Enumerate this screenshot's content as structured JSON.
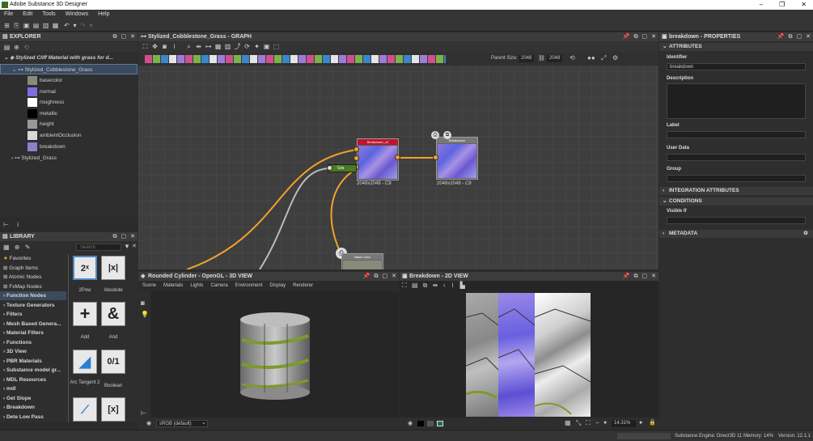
{
  "app": {
    "title": "Adobe Substance 3D Designer",
    "window_controls": [
      "–",
      "❐",
      "✕"
    ]
  },
  "menu": [
    "File",
    "Edit",
    "Tools",
    "Windows",
    "Help"
  ],
  "explorer": {
    "title": "EXPLORER",
    "package": "Stylized Cliff Material with grass for d...",
    "graph": "Stylized_Cobblestone_Grass",
    "outputs": [
      "basecolor",
      "normal",
      "roughness",
      "metallic",
      "height",
      "ambientOcclusion",
      "breakdown"
    ],
    "other_graph": "Stylized_Grass"
  },
  "library": {
    "title": "LIBRARY",
    "search_placeholder": "Search",
    "categories": [
      "Favorites",
      "Graph Items",
      "Atomic Nodes",
      "FxMap Nodes",
      "Function Nodes",
      "Texture Generators",
      "Filters",
      "Mesh Based Genera...",
      "Material Filters",
      "Functions",
      "3D View",
      "PBR Materials",
      "Substance model gr...",
      "MDL Resources",
      "mdl",
      "Get Slope",
      "Breakdown",
      "Dete Low Pass"
    ],
    "selected_category": "Function Nodes",
    "tiles": [
      {
        "glyph": "2ˣ",
        "caption": "2Pow"
      },
      {
        "glyph": "|x|",
        "caption": "Absolute"
      },
      {
        "glyph": "+",
        "caption": "Add"
      },
      {
        "glyph": "&",
        "caption": "And"
      },
      {
        "glyph": "◢",
        "caption": "Arc Tangent 2"
      },
      {
        "glyph": "0/1",
        "caption": "Boolean"
      },
      {
        "glyph": "⟋",
        "caption": ""
      },
      {
        "glyph": "[x]",
        "caption": ""
      }
    ]
  },
  "graph": {
    "title": "Stylized_Cobblestone_Grass - GRAPH",
    "parent_size_label": "Parent Size:",
    "parent_size": "2048",
    "size_b": "2048",
    "nodes": [
      {
        "name": "Breakdown_x2",
        "size": "2048x2048 - C8"
      },
      {
        "name": "Breakdown",
        "size": "2048x2048 - C8"
      },
      {
        "name": "Base Color",
        "size": ""
      }
    ],
    "reroute_label": "Gra"
  },
  "view3d": {
    "title": "Rounded Cylinder - OpenGL - 3D VIEW",
    "menu": [
      "Scene",
      "Materials",
      "Lights",
      "Camera",
      "Environment",
      "Display",
      "Renderer"
    ],
    "colorspace": "sRGB (default)"
  },
  "view2d": {
    "title": "Breakdown - 2D VIEW",
    "zoom": "14.31%"
  },
  "properties": {
    "title": "breakdown - PROPERTIES",
    "sections": [
      "ATTRIBUTES",
      "INTEGRATION ATTRIBUTES",
      "CONDITIONS",
      "METADATA"
    ],
    "identifier_label": "Identifier",
    "identifier_value": "breakdown",
    "description_label": "Description",
    "label_label": "Label",
    "userdata_label": "User Data",
    "group_label": "Group",
    "visible_if_label": "Visible If"
  },
  "status": {
    "engine": "Substance Engine: Direct3D 11  Memory: 14%",
    "version": "Version: 12.1.1"
  },
  "colors": {
    "accent_orange": "#f2a12b",
    "node_red": "#c0142c",
    "selection": "#3b4a5c",
    "grass_node": "#5a8a2a"
  }
}
